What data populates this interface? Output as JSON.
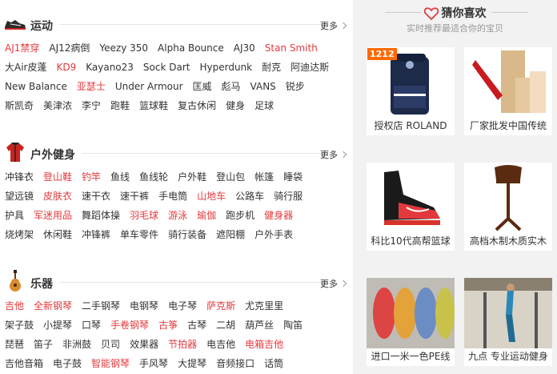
{
  "sports": {
    "title": "运动",
    "more": "更多",
    "rows": [
      [
        {
          "t": "AJ1禁穿",
          "hot": true
        },
        {
          "t": "AJ12病倒"
        },
        {
          "t": "Yeezy 350"
        },
        {
          "t": "Alpha Bounce"
        },
        {
          "t": "AJ30"
        },
        {
          "t": "Stan Smith",
          "hot": true
        }
      ],
      [
        {
          "t": "大Air皮蓬"
        },
        {
          "t": "KD9",
          "hot": true
        },
        {
          "t": "Kayano23"
        },
        {
          "t": "Sock Dart"
        },
        {
          "t": "Hyperdunk"
        },
        {
          "t": "耐克"
        },
        {
          "t": "阿迪达斯"
        }
      ],
      [
        {
          "t": "New Balance"
        },
        {
          "t": "亚瑟士",
          "hot": true
        },
        {
          "t": "Under Armour"
        },
        {
          "t": "匡威"
        },
        {
          "t": "彪马"
        },
        {
          "t": "VANS"
        },
        {
          "t": "锐步"
        }
      ],
      [
        {
          "t": "斯凯奇"
        },
        {
          "t": "美津浓"
        },
        {
          "t": "李宁"
        },
        {
          "t": "跑鞋"
        },
        {
          "t": "篮球鞋"
        },
        {
          "t": "复古休闲"
        },
        {
          "t": "健身"
        },
        {
          "t": "足球"
        }
      ]
    ]
  },
  "outdoor": {
    "title": "户外健身",
    "more": "更多",
    "rows": [
      [
        {
          "t": "冲锋衣"
        },
        {
          "t": "登山鞋",
          "hot": true
        },
        {
          "t": "钓竿",
          "hot": true
        },
        {
          "t": "鱼线"
        },
        {
          "t": "鱼线轮"
        },
        {
          "t": "户外鞋"
        },
        {
          "t": "登山包"
        },
        {
          "t": "帐篷"
        },
        {
          "t": "睡袋"
        }
      ],
      [
        {
          "t": "望远镜"
        },
        {
          "t": "皮肤衣",
          "hot": true
        },
        {
          "t": "速干衣"
        },
        {
          "t": "速干裤"
        },
        {
          "t": "手电筒"
        },
        {
          "t": "山地车",
          "hot": true
        },
        {
          "t": "公路车"
        },
        {
          "t": "骑行服"
        }
      ],
      [
        {
          "t": "护具"
        },
        {
          "t": "军迷用品",
          "hot": true
        },
        {
          "t": "舞蹈体操"
        },
        {
          "t": "羽毛球",
          "hot": true
        },
        {
          "t": "游泳",
          "hot": true
        },
        {
          "t": "瑜伽",
          "hot": true
        },
        {
          "t": "跑步机"
        },
        {
          "t": "健身器",
          "hot": true
        }
      ],
      [
        {
          "t": "烧烤架"
        },
        {
          "t": "休闲鞋"
        },
        {
          "t": "冲锋裤"
        },
        {
          "t": "单车零件"
        },
        {
          "t": "骑行装备"
        },
        {
          "t": "遮阳棚"
        },
        {
          "t": "户外手表"
        }
      ]
    ]
  },
  "music": {
    "title": "乐器",
    "more": "更多",
    "rows": [
      [
        {
          "t": "吉他",
          "hot": true
        },
        {
          "t": "全新钢琴",
          "hot": true
        },
        {
          "t": "二手钢琴"
        },
        {
          "t": "电钢琴"
        },
        {
          "t": "电子琴"
        },
        {
          "t": "萨克斯",
          "hot": true
        },
        {
          "t": "尤克里里"
        }
      ],
      [
        {
          "t": "架子鼓"
        },
        {
          "t": "小提琴"
        },
        {
          "t": "口琴"
        },
        {
          "t": "手卷钢琴",
          "hot": true
        },
        {
          "t": "古筝",
          "hot": true
        },
        {
          "t": "古琴"
        },
        {
          "t": "二胡"
        },
        {
          "t": "葫芦丝"
        },
        {
          "t": "陶笛"
        }
      ],
      [
        {
          "t": "琵琶"
        },
        {
          "t": "笛子"
        },
        {
          "t": "非洲鼓"
        },
        {
          "t": "贝司"
        },
        {
          "t": "效果器"
        },
        {
          "t": "节拍器",
          "hot": true
        },
        {
          "t": "电吉他"
        },
        {
          "t": "电箱吉他",
          "hot": true
        }
      ],
      [
        {
          "t": "吉他音箱"
        },
        {
          "t": "电子鼓"
        },
        {
          "t": "智能钢琴",
          "hot": true
        },
        {
          "t": "手风琴"
        },
        {
          "t": "大提琴"
        },
        {
          "t": "音频接口"
        },
        {
          "t": "话筒"
        }
      ]
    ]
  },
  "guess": {
    "title": "猜你喜欢",
    "subtitle": "实时推荐最适合你的宝贝",
    "items": [
      {
        "caption": "授权店 ROLAND",
        "badge": "1212"
      },
      {
        "caption": "厂家批发中国传统"
      },
      {
        "caption": "科比10代高帮篮球"
      },
      {
        "caption": "高档木制木质实木"
      },
      {
        "caption": "进口一米一色PE线"
      },
      {
        "caption": "九点 专业运动健身"
      }
    ]
  },
  "colors": {
    "hot": "#e4393c",
    "text": "#333333",
    "accent": "#ff6a00"
  }
}
